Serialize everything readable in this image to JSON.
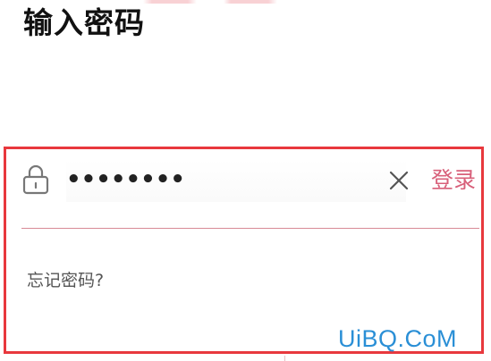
{
  "header": {
    "title": "输入密码"
  },
  "password_form": {
    "masked_value": "••••••••",
    "login_label": "登录",
    "forgot_label": "忘记密码?"
  },
  "watermark": {
    "text": "UiBQ.CoM"
  },
  "colors": {
    "highlight_border": "#e8383d",
    "accent": "#d8607a",
    "divider": "#d88a96",
    "watermark": "#2a8fd6"
  },
  "icons": {
    "lock": "lock-icon",
    "clear": "close-icon"
  }
}
